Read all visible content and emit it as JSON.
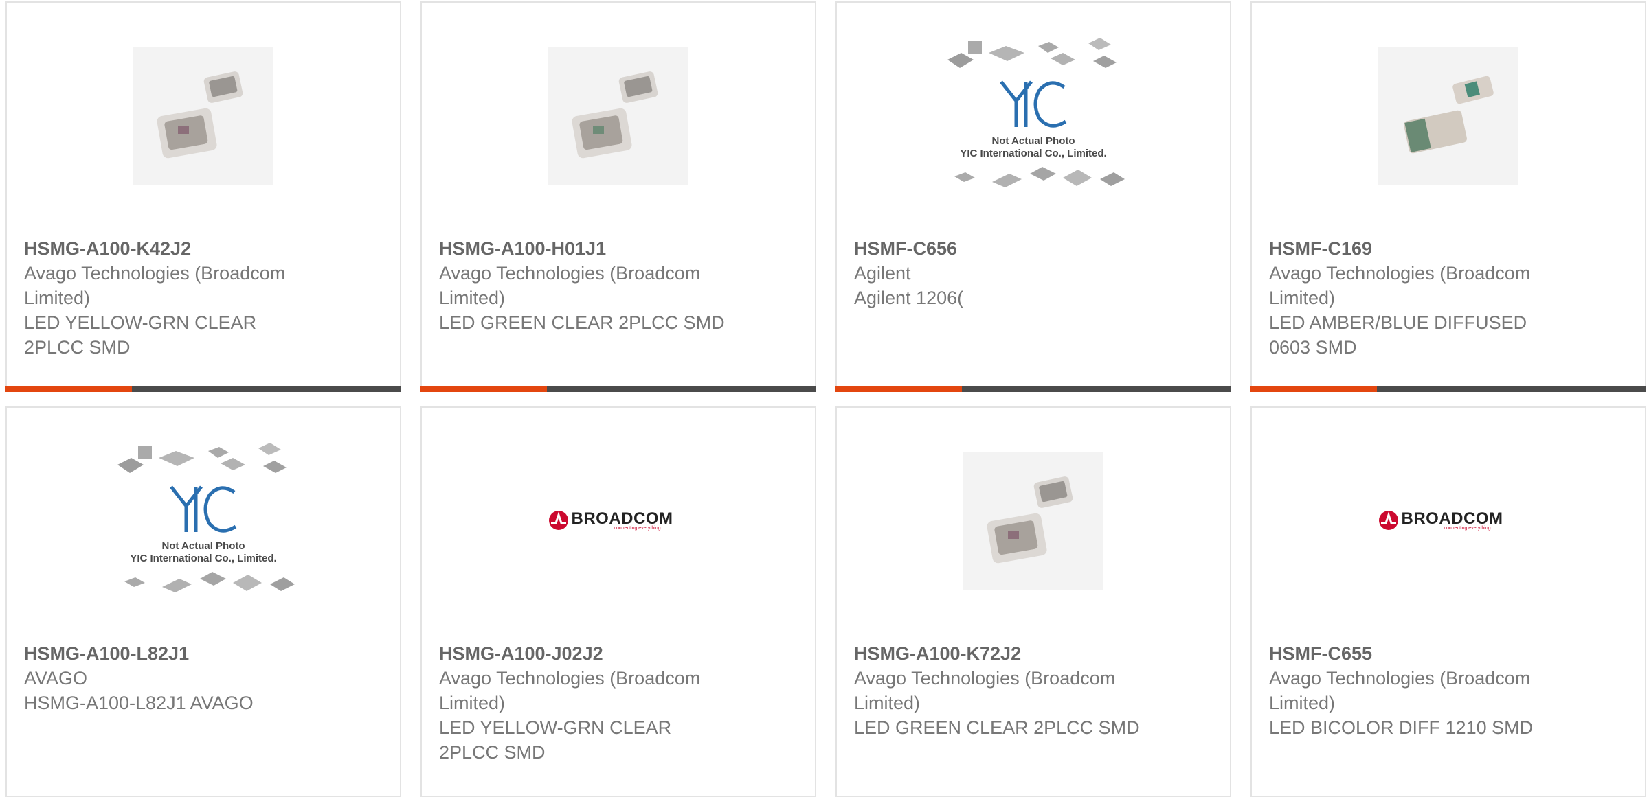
{
  "products": [
    {
      "part_number": "HSMG-A100-K42J2",
      "manufacturer": "Avago Technologies (Broadcom Limited)",
      "description": "LED YELLOW-GRN CLEAR 2PLCC SMD",
      "image": "led-2plcc-photo"
    },
    {
      "part_number": "HSMG-A100-H01J1",
      "manufacturer": "Avago Technologies (Broadcom Limited)",
      "description": "LED GREEN CLEAR 2PLCC SMD",
      "image": "led-2plcc-photo"
    },
    {
      "part_number": "HSMF-C656",
      "manufacturer": "Agilent",
      "description": "Agilent 1206(",
      "image": "yic-placeholder"
    },
    {
      "part_number": "HSMF-C169",
      "manufacturer": "Avago Technologies (Broadcom Limited)",
      "description": "LED AMBER/BLUE DIFFUSED 0603 SMD",
      "image": "led-0603-photo"
    },
    {
      "part_number": "HSMG-A100-L82J1",
      "manufacturer": "AVAGO",
      "description": "HSMG-A100-L82J1 AVAGO",
      "image": "yic-placeholder"
    },
    {
      "part_number": "HSMG-A100-J02J2",
      "manufacturer": "Avago Technologies (Broadcom Limited)",
      "description": "LED YELLOW-GRN CLEAR 2PLCC SMD",
      "image": "broadcom-logo"
    },
    {
      "part_number": "HSMG-A100-K72J2",
      "manufacturer": "Avago Technologies (Broadcom Limited)",
      "description": "LED GREEN CLEAR 2PLCC SMD",
      "image": "led-2plcc-photo"
    },
    {
      "part_number": "HSMF-C655",
      "manufacturer": "Avago Technologies (Broadcom Limited)",
      "description": "LED BICOLOR DIFF 1210 SMD",
      "image": "broadcom-logo"
    }
  ],
  "placeholder_image": {
    "line1": "Not Actual Photo",
    "line2": "YIC International Co., Limited.",
    "logo_text": "YIC"
  },
  "broadcom_logo": {
    "name": "BROADCOM",
    "tagline": "connecting everything"
  },
  "colors": {
    "accent": "#e3460f",
    "bar": "#4b4b4b",
    "border": "#e3e3e3",
    "logo_blue": "#2a6fb0",
    "broadcom_red": "#cc092f"
  }
}
